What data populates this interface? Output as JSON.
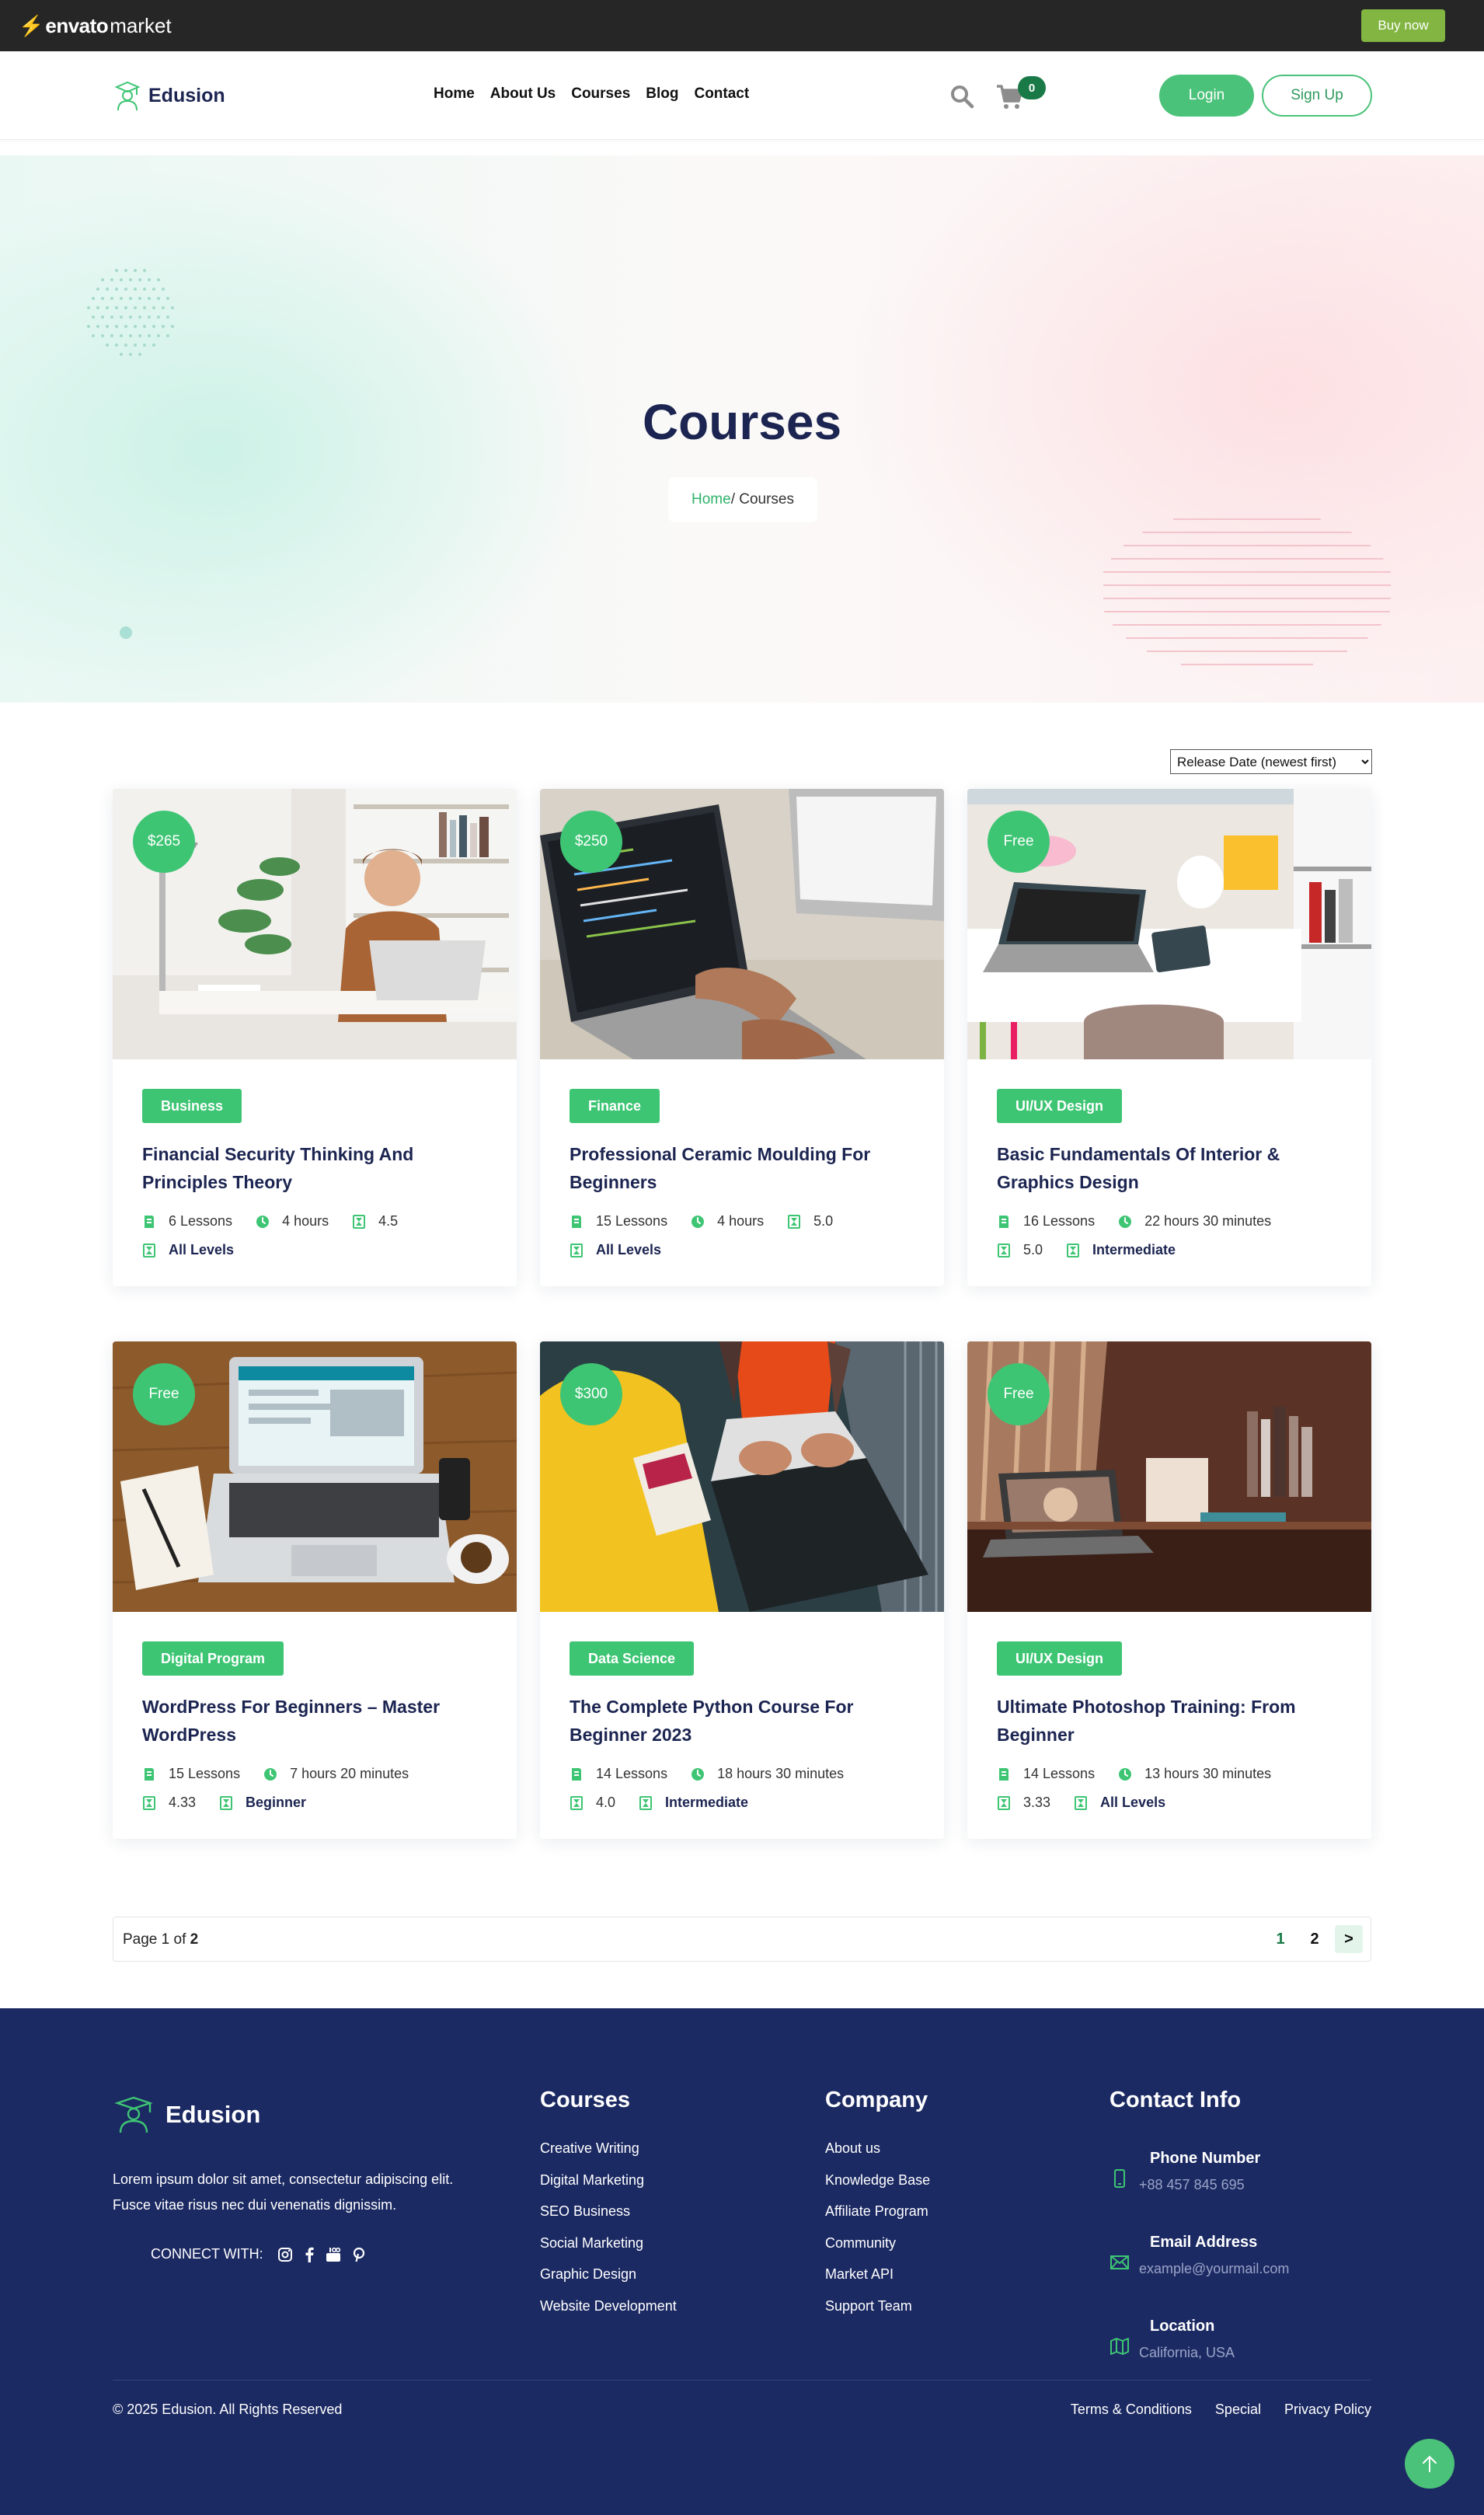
{
  "envato": {
    "logo_bold": "envato",
    "logo_light": "market",
    "buy_now": "Buy now"
  },
  "header": {
    "brand": "Edusion",
    "nav": [
      "Home",
      "About Us",
      "Courses",
      "Blog",
      "Contact"
    ],
    "cart_count": "0",
    "login": "Login",
    "signup": "Sign Up"
  },
  "hero": {
    "title": "Courses",
    "breadcrumb_home": "Home",
    "breadcrumb_sep": "/",
    "breadcrumb_current": "Courses"
  },
  "sort": {
    "selected": "Release Date (newest first)"
  },
  "courses": [
    {
      "price": "$265",
      "category": "Business",
      "title": "Financial Security Thinking And Principles Theory",
      "row1": [
        "6 Lessons",
        "4 hours",
        "4.5"
      ],
      "row2": [
        "All Levels"
      ]
    },
    {
      "price": "$250",
      "category": "Finance",
      "title": "Professional Ceramic Moulding For Beginners",
      "row1": [
        "15 Lessons",
        "4 hours",
        "5.0"
      ],
      "row2": [
        "All Levels"
      ]
    },
    {
      "price": "Free",
      "category": "UI/UX Design",
      "title": "Basic Fundamentals Of Interior & Graphics Design",
      "row1": [
        "16 Lessons",
        "22 hours 30 minutes"
      ],
      "row2": [
        "5.0",
        "Intermediate"
      ]
    },
    {
      "price": "Free",
      "category": "Digital Program",
      "title": "WordPress For Beginners – Master WordPress",
      "row1": [
        "15 Lessons",
        "7 hours 20 minutes"
      ],
      "row2": [
        "4.33",
        "Beginner"
      ]
    },
    {
      "price": "$300",
      "category": "Data Science",
      "title": "The Complete Python Course For Beginner 2023",
      "row1": [
        "14 Lessons",
        "18 hours 30 minutes"
      ],
      "row2": [
        "4.0",
        "Intermediate"
      ]
    },
    {
      "price": "Free",
      "category": "UI/UX Design",
      "title": "Ultimate Photoshop Training: From Beginner",
      "row1": [
        "14 Lessons",
        "13 hours 30 minutes"
      ],
      "row2": [
        "3.33",
        "All Levels"
      ]
    }
  ],
  "pagination": {
    "prefix": "Page",
    "current": "1",
    "of": "of",
    "total": "2",
    "pages": [
      "1",
      "2"
    ],
    "next": ">"
  },
  "footer": {
    "brand": "Edusion",
    "about": "Lorem ipsum dolor sit amet, consectetur adipiscing elit. Fusce vitae risus nec dui venenatis dignissim.",
    "connect_label": "CONNECT WITH:",
    "courses_title": "Courses",
    "courses_links": [
      "Creative Writing",
      "Digital Marketing",
      "SEO Business",
      "Social Marketing",
      "Graphic Design",
      "Website Development"
    ],
    "company_title": "Company",
    "company_links": [
      "About us",
      "Knowledge Base",
      "Affiliate Program",
      "Community",
      "Market API",
      "Support Team"
    ],
    "contact_title": "Contact Info",
    "phone_label": "Phone Number",
    "phone": "+88 457 845 695",
    "email_label": "Email Address",
    "email": "example@yourmail.com",
    "location_label": "Location",
    "location": "California, USA",
    "copyright": "© 2025 Edusion. All Rights Reserved",
    "legal": [
      "Terms & Conditions",
      "Special",
      "Privacy Policy"
    ]
  },
  "colors": {
    "accent": "#3ec574",
    "navy": "#1c2551",
    "footer_bg": "#1c2a63",
    "envato_green": "#82b541"
  }
}
